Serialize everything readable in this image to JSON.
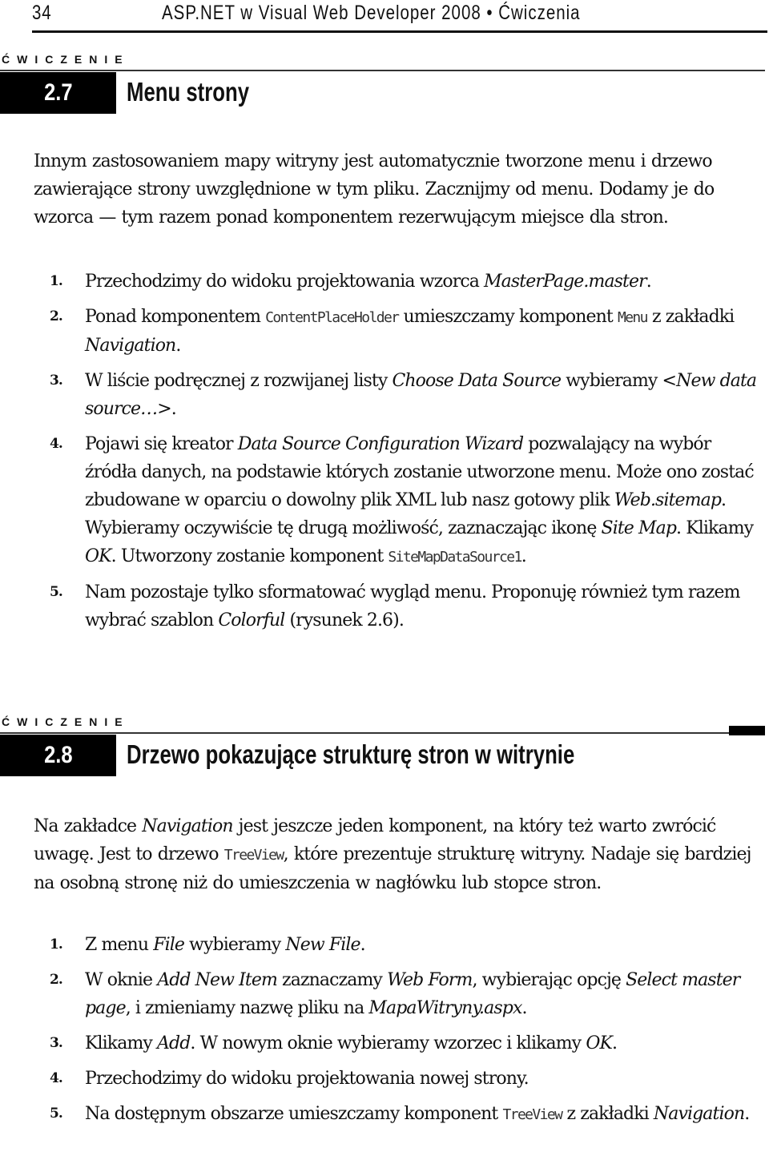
{
  "running_head": {
    "page_number": "34",
    "book_title": "ASP.NET w Visual Web Developer 2008 • Ćwiczenia"
  },
  "exercises": [
    {
      "label": "ĆWICZENIE",
      "number": "2.7",
      "title": "Menu strony",
      "intro": [
        {
          "t": "Innym zastosowaniem mapy witryny jest automatycznie tworzone menu i drzewo zawierające strony uwzględnione w tym pliku. Zacznijmy od menu. Dodamy je do wzorca — tym razem ponad komponentem rezerwującym miejsce dla stron."
        }
      ],
      "steps": [
        {
          "num": "1.",
          "text": [
            {
              "t": "Przechodzimy do widoku projektowania wzorca "
            },
            {
              "i": "MasterPage.master"
            },
            {
              "t": "."
            }
          ]
        },
        {
          "num": "2.",
          "text": [
            {
              "t": "Ponad komponentem "
            },
            {
              "c": "ContentPlaceHolder"
            },
            {
              "t": " umieszczamy komponent "
            },
            {
              "c": "Menu"
            },
            {
              "t": " z zakładki "
            },
            {
              "i": "Navigation"
            },
            {
              "t": "."
            }
          ]
        },
        {
          "num": "3.",
          "text": [
            {
              "t": "W liście podręcznej z rozwijanej listy "
            },
            {
              "i": "Choose Data Source"
            },
            {
              "t": " wybieramy <"
            },
            {
              "i": "New data source…"
            },
            {
              "t": ">."
            }
          ]
        },
        {
          "num": "4.",
          "text": [
            {
              "t": "Pojawi się kreator "
            },
            {
              "i": "Data Source Configuration Wizard"
            },
            {
              "t": " pozwalający na wybór źródła danych, na podstawie których zostanie utworzone menu. Może ono zostać zbudowane w oparciu o dowolny plik XML lub nasz gotowy plik "
            },
            {
              "i": "Web.sitemap"
            },
            {
              "t": ". Wybieramy oczywiście tę drugą możliwość, zaznaczając ikonę "
            },
            {
              "i": "Site Map"
            },
            {
              "t": ". Klikamy "
            },
            {
              "i": "OK"
            },
            {
              "t": ". Utworzony zostanie komponent "
            },
            {
              "c": "SiteMapDataSource1"
            },
            {
              "t": "."
            }
          ]
        },
        {
          "num": "5.",
          "text": [
            {
              "t": "Nam pozostaje tylko sformatować wygląd menu. Proponuję również tym razem wybrać szablon "
            },
            {
              "i": "Colorful"
            },
            {
              "t": " (rysunek 2.6)."
            }
          ]
        }
      ]
    },
    {
      "label": "ĆWICZENIE",
      "number": "2.8",
      "title": "Drzewo pokazujące strukturę stron w witrynie",
      "intro": [
        {
          "t": "Na zakładce "
        },
        {
          "i": "Navigation"
        },
        {
          "t": " jest jeszcze jeden komponent, na który też warto zwrócić uwagę. Jest to drzewo "
        },
        {
          "c": "TreeView"
        },
        {
          "t": ", które prezentuje strukturę witryny. Nadaje się bardziej na osobną stronę niż do umieszczenia w nagłówku lub stopce stron."
        }
      ],
      "steps": [
        {
          "num": "1.",
          "text": [
            {
              "t": "Z menu "
            },
            {
              "i": "File"
            },
            {
              "t": " wybieramy "
            },
            {
              "i": "New File"
            },
            {
              "t": "."
            }
          ]
        },
        {
          "num": "2.",
          "text": [
            {
              "t": "W oknie "
            },
            {
              "i": "Add New Item"
            },
            {
              "t": " zaznaczamy "
            },
            {
              "i": "Web Form"
            },
            {
              "t": ", wybierając opcję "
            },
            {
              "i": "Select master page"
            },
            {
              "t": ", i zmieniamy nazwę pliku na "
            },
            {
              "i": "MapaWitryny.aspx"
            },
            {
              "t": "."
            }
          ]
        },
        {
          "num": "3.",
          "text": [
            {
              "t": "Klikamy "
            },
            {
              "i": "Add"
            },
            {
              "t": ". W nowym oknie wybieramy wzorzec i klikamy "
            },
            {
              "i": "OK"
            },
            {
              "t": "."
            }
          ]
        },
        {
          "num": "4.",
          "text": [
            {
              "t": "Przechodzimy do widoku projektowania nowej strony."
            }
          ]
        },
        {
          "num": "5.",
          "text": [
            {
              "t": "Na dostępnym obszarze umieszczamy komponent "
            },
            {
              "c": "TreeView"
            },
            {
              "t": " z zakładki "
            },
            {
              "i": "Navigation"
            },
            {
              "t": "."
            }
          ]
        }
      ]
    }
  ]
}
